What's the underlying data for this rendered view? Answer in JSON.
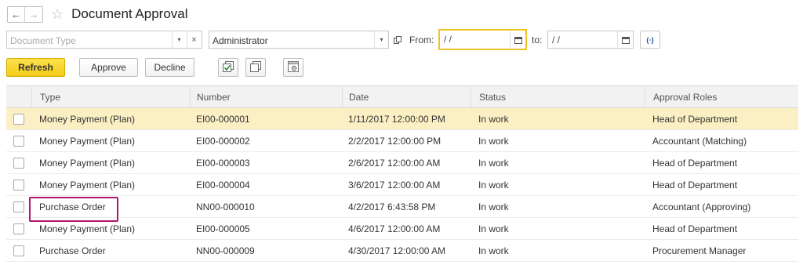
{
  "header": {
    "back_glyph": "←",
    "forward_glyph": "→",
    "favorite_icon": "☆",
    "title": "Document Approval"
  },
  "filters": {
    "document_type_placeholder": "Document Type",
    "dropdown_glyph": "▾",
    "clear_glyph": "×",
    "user_value": "Administrator",
    "from_label": "From:",
    "from_value": " /  /",
    "to_label": "to:",
    "to_value": " /  /",
    "period_glyph": "(◦)"
  },
  "toolbar": {
    "refresh_label": "Refresh",
    "approve_label": "Approve",
    "decline_label": "Decline"
  },
  "table": {
    "columns": [
      "Type",
      "Number",
      "Date",
      "Status",
      "Approval Roles"
    ],
    "rows": [
      {
        "type": "Money Payment (Plan)",
        "number": "EI00-000001",
        "date": "1/11/2017 12:00:00 PM",
        "status": "In work",
        "role": "Head of Department"
      },
      {
        "type": "Money Payment (Plan)",
        "number": "EI00-000002",
        "date": "2/2/2017 12:00:00 PM",
        "status": "In work",
        "role": "Accountant (Matching)"
      },
      {
        "type": "Money Payment (Plan)",
        "number": "EI00-000003",
        "date": "2/6/2017 12:00:00 AM",
        "status": "In work",
        "role": "Head of Department"
      },
      {
        "type": "Money Payment (Plan)",
        "number": "EI00-000004",
        "date": "3/6/2017 12:00:00 AM",
        "status": "In work",
        "role": "Head of Department"
      },
      {
        "type": "Purchase Order",
        "number": "NN00-000010",
        "date": "4/2/2017 6:43:58 PM",
        "status": "In work",
        "role": "Accountant (Approving)"
      },
      {
        "type": "Money Payment (Plan)",
        "number": "EI00-000005",
        "date": "4/6/2017 12:00:00 AM",
        "status": "In work",
        "role": "Head of Department"
      },
      {
        "type": "Purchase Order",
        "number": "NN00-000009",
        "date": "4/30/2017 12:00:00 AM",
        "status": "In work",
        "role": "Procurement Manager"
      }
    ]
  },
  "colors": {
    "accent_yellow": "#f4cc16",
    "selected_row": "#fbf0c4",
    "highlight_outline": "#b0156d",
    "focus_border": "#f1c32c"
  }
}
